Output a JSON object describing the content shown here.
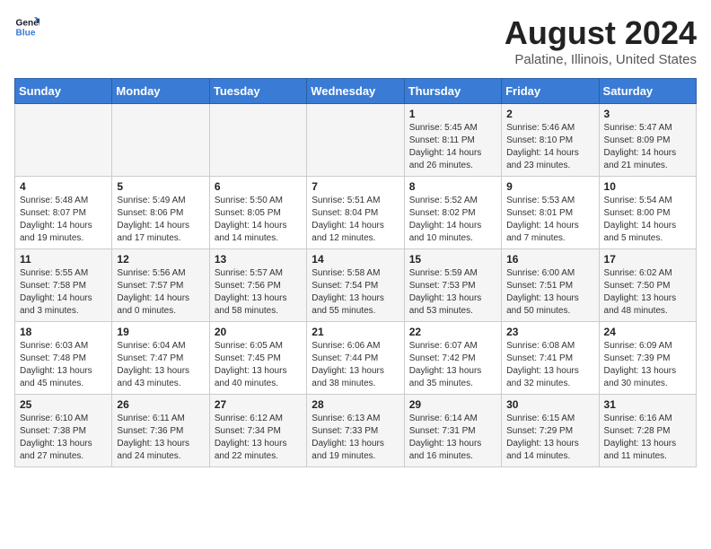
{
  "logo": {
    "line1": "General",
    "line2": "Blue"
  },
  "title": "August 2024",
  "subtitle": "Palatine, Illinois, United States",
  "days_of_week": [
    "Sunday",
    "Monday",
    "Tuesday",
    "Wednesday",
    "Thursday",
    "Friday",
    "Saturday"
  ],
  "weeks": [
    [
      {
        "day": "",
        "info": ""
      },
      {
        "day": "",
        "info": ""
      },
      {
        "day": "",
        "info": ""
      },
      {
        "day": "",
        "info": ""
      },
      {
        "day": "1",
        "info": "Sunrise: 5:45 AM\nSunset: 8:11 PM\nDaylight: 14 hours\nand 26 minutes."
      },
      {
        "day": "2",
        "info": "Sunrise: 5:46 AM\nSunset: 8:10 PM\nDaylight: 14 hours\nand 23 minutes."
      },
      {
        "day": "3",
        "info": "Sunrise: 5:47 AM\nSunset: 8:09 PM\nDaylight: 14 hours\nand 21 minutes."
      }
    ],
    [
      {
        "day": "4",
        "info": "Sunrise: 5:48 AM\nSunset: 8:07 PM\nDaylight: 14 hours\nand 19 minutes."
      },
      {
        "day": "5",
        "info": "Sunrise: 5:49 AM\nSunset: 8:06 PM\nDaylight: 14 hours\nand 17 minutes."
      },
      {
        "day": "6",
        "info": "Sunrise: 5:50 AM\nSunset: 8:05 PM\nDaylight: 14 hours\nand 14 minutes."
      },
      {
        "day": "7",
        "info": "Sunrise: 5:51 AM\nSunset: 8:04 PM\nDaylight: 14 hours\nand 12 minutes."
      },
      {
        "day": "8",
        "info": "Sunrise: 5:52 AM\nSunset: 8:02 PM\nDaylight: 14 hours\nand 10 minutes."
      },
      {
        "day": "9",
        "info": "Sunrise: 5:53 AM\nSunset: 8:01 PM\nDaylight: 14 hours\nand 7 minutes."
      },
      {
        "day": "10",
        "info": "Sunrise: 5:54 AM\nSunset: 8:00 PM\nDaylight: 14 hours\nand 5 minutes."
      }
    ],
    [
      {
        "day": "11",
        "info": "Sunrise: 5:55 AM\nSunset: 7:58 PM\nDaylight: 14 hours\nand 3 minutes."
      },
      {
        "day": "12",
        "info": "Sunrise: 5:56 AM\nSunset: 7:57 PM\nDaylight: 14 hours\nand 0 minutes."
      },
      {
        "day": "13",
        "info": "Sunrise: 5:57 AM\nSunset: 7:56 PM\nDaylight: 13 hours\nand 58 minutes."
      },
      {
        "day": "14",
        "info": "Sunrise: 5:58 AM\nSunset: 7:54 PM\nDaylight: 13 hours\nand 55 minutes."
      },
      {
        "day": "15",
        "info": "Sunrise: 5:59 AM\nSunset: 7:53 PM\nDaylight: 13 hours\nand 53 minutes."
      },
      {
        "day": "16",
        "info": "Sunrise: 6:00 AM\nSunset: 7:51 PM\nDaylight: 13 hours\nand 50 minutes."
      },
      {
        "day": "17",
        "info": "Sunrise: 6:02 AM\nSunset: 7:50 PM\nDaylight: 13 hours\nand 48 minutes."
      }
    ],
    [
      {
        "day": "18",
        "info": "Sunrise: 6:03 AM\nSunset: 7:48 PM\nDaylight: 13 hours\nand 45 minutes."
      },
      {
        "day": "19",
        "info": "Sunrise: 6:04 AM\nSunset: 7:47 PM\nDaylight: 13 hours\nand 43 minutes."
      },
      {
        "day": "20",
        "info": "Sunrise: 6:05 AM\nSunset: 7:45 PM\nDaylight: 13 hours\nand 40 minutes."
      },
      {
        "day": "21",
        "info": "Sunrise: 6:06 AM\nSunset: 7:44 PM\nDaylight: 13 hours\nand 38 minutes."
      },
      {
        "day": "22",
        "info": "Sunrise: 6:07 AM\nSunset: 7:42 PM\nDaylight: 13 hours\nand 35 minutes."
      },
      {
        "day": "23",
        "info": "Sunrise: 6:08 AM\nSunset: 7:41 PM\nDaylight: 13 hours\nand 32 minutes."
      },
      {
        "day": "24",
        "info": "Sunrise: 6:09 AM\nSunset: 7:39 PM\nDaylight: 13 hours\nand 30 minutes."
      }
    ],
    [
      {
        "day": "25",
        "info": "Sunrise: 6:10 AM\nSunset: 7:38 PM\nDaylight: 13 hours\nand 27 minutes."
      },
      {
        "day": "26",
        "info": "Sunrise: 6:11 AM\nSunset: 7:36 PM\nDaylight: 13 hours\nand 24 minutes."
      },
      {
        "day": "27",
        "info": "Sunrise: 6:12 AM\nSunset: 7:34 PM\nDaylight: 13 hours\nand 22 minutes."
      },
      {
        "day": "28",
        "info": "Sunrise: 6:13 AM\nSunset: 7:33 PM\nDaylight: 13 hours\nand 19 minutes."
      },
      {
        "day": "29",
        "info": "Sunrise: 6:14 AM\nSunset: 7:31 PM\nDaylight: 13 hours\nand 16 minutes."
      },
      {
        "day": "30",
        "info": "Sunrise: 6:15 AM\nSunset: 7:29 PM\nDaylight: 13 hours\nand 14 minutes."
      },
      {
        "day": "31",
        "info": "Sunrise: 6:16 AM\nSunset: 7:28 PM\nDaylight: 13 hours\nand 11 minutes."
      }
    ]
  ]
}
